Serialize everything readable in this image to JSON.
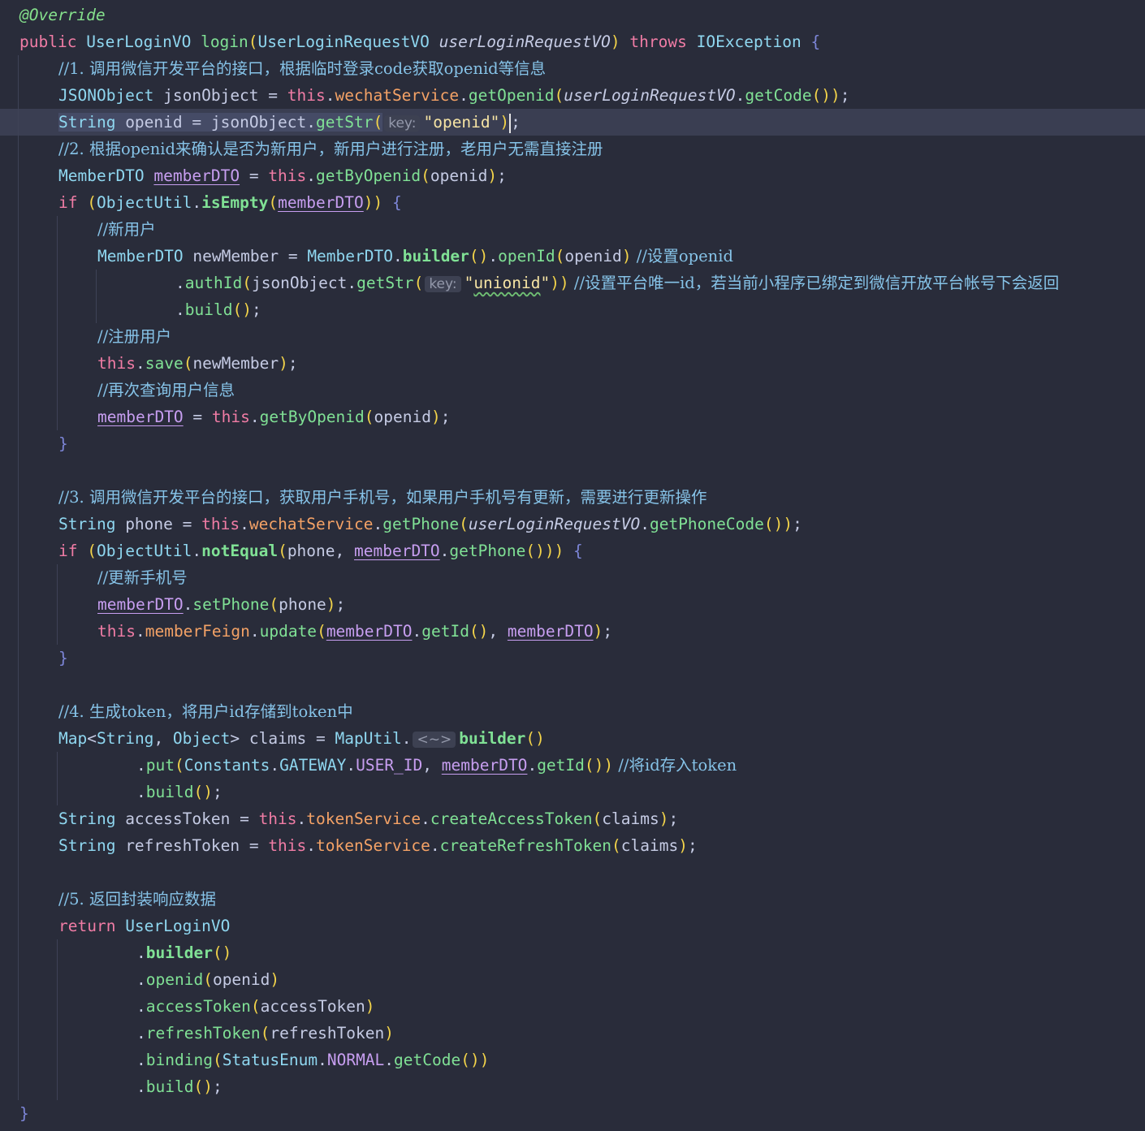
{
  "editor": {
    "language": "Java",
    "colors": {
      "background": "#292c3a",
      "current_line": "#3a3e52",
      "keyword": "#f07ca5",
      "type": "#8fd7f0",
      "method": "#80e195",
      "field": "#f4a266",
      "string": "#f6e4a4",
      "comment": "#86c3e8",
      "reassigned_variable": "#c79ef0"
    },
    "current_line_index": 4,
    "lines": [
      {
        "indent": 0,
        "tokens": [
          [
            "annot",
            "@Override"
          ]
        ]
      },
      {
        "indent": 0,
        "tokens": [
          [
            "kw",
            "public "
          ],
          [
            "cls",
            "UserLoginVO "
          ],
          [
            "fn",
            "login"
          ],
          [
            "paren",
            "("
          ],
          [
            "cls",
            "UserLoginRequestVO "
          ],
          [
            "param",
            "userLoginRequestVO"
          ],
          [
            "paren",
            ")"
          ],
          [
            "kw",
            " throws "
          ],
          [
            "cls",
            "IOException "
          ],
          [
            "brace",
            "{"
          ]
        ]
      },
      {
        "indent": 1,
        "tokens": [
          [
            "cmt",
            "//1. 调用微信开发平台的接口，根据临时登录code获取openid等信息"
          ]
        ]
      },
      {
        "indent": 1,
        "tokens": [
          [
            "cls",
            "JSONObject "
          ],
          [
            "local",
            "jsonObject"
          ],
          [
            "punct",
            " = "
          ],
          [
            "kw",
            "this"
          ],
          [
            "punct",
            "."
          ],
          [
            "field",
            "wechatService"
          ],
          [
            "punct",
            "."
          ],
          [
            "fn",
            "getOpenid"
          ],
          [
            "paren",
            "("
          ],
          [
            "param",
            "userLoginRequestVO"
          ],
          [
            "punct",
            "."
          ],
          [
            "fn",
            "getCode"
          ],
          [
            "paren",
            "())"
          ],
          [
            "punct",
            ";"
          ]
        ]
      },
      {
        "indent": 1,
        "tokens": [
          [
            "cls sel",
            "String"
          ],
          [
            "local sel",
            " openid = "
          ],
          [
            "local sel",
            "jsonObject"
          ],
          [
            "punct sel",
            "."
          ],
          [
            "fn sel",
            "getStr"
          ],
          [
            "paren sel",
            "("
          ],
          [
            "hint",
            "key:"
          ],
          [
            "str",
            "\"openid\""
          ],
          [
            "paren",
            ")"
          ],
          [
            "caret",
            ""
          ],
          [
            "punct",
            ";"
          ]
        ]
      },
      {
        "indent": 1,
        "tokens": [
          [
            "cmt",
            "//2. 根据openid来确认是否为新用户，新用户进行注册，老用户无需直接注册"
          ]
        ]
      },
      {
        "indent": 1,
        "tokens": [
          [
            "cls",
            "MemberDTO "
          ],
          [
            "var",
            "memberDTO"
          ],
          [
            "punct",
            " = "
          ],
          [
            "kw",
            "this"
          ],
          [
            "punct",
            "."
          ],
          [
            "fn",
            "getByOpenid"
          ],
          [
            "paren",
            "("
          ],
          [
            "local",
            "openid"
          ],
          [
            "paren",
            ")"
          ],
          [
            "punct",
            ";"
          ]
        ]
      },
      {
        "indent": 1,
        "tokens": [
          [
            "kw",
            "if "
          ],
          [
            "paren",
            "("
          ],
          [
            "cls",
            "ObjectUtil"
          ],
          [
            "punct",
            "."
          ],
          [
            "fnb",
            "isEmpty"
          ],
          [
            "paren",
            "("
          ],
          [
            "var",
            "memberDTO"
          ],
          [
            "paren",
            "))"
          ],
          [
            "brace",
            " {"
          ]
        ]
      },
      {
        "indent": 2,
        "tokens": [
          [
            "cmt",
            "//新用户"
          ]
        ]
      },
      {
        "indent": 2,
        "tokens": [
          [
            "cls",
            "MemberDTO "
          ],
          [
            "local",
            "newMember"
          ],
          [
            "punct",
            " = "
          ],
          [
            "cls",
            "MemberDTO"
          ],
          [
            "punct",
            "."
          ],
          [
            "fnb",
            "builder"
          ],
          [
            "paren",
            "()"
          ],
          [
            "punct",
            "."
          ],
          [
            "fn",
            "openId"
          ],
          [
            "paren",
            "("
          ],
          [
            "local",
            "openid"
          ],
          [
            "paren",
            ")"
          ],
          [
            "cmt",
            " //设置openid"
          ]
        ]
      },
      {
        "indent": 4,
        "tokens": [
          [
            "punct",
            "."
          ],
          [
            "fn",
            "authId"
          ],
          [
            "paren",
            "("
          ],
          [
            "local",
            "jsonObject"
          ],
          [
            "punct",
            "."
          ],
          [
            "fn",
            "getStr"
          ],
          [
            "paren",
            "("
          ],
          [
            "hint",
            "key:"
          ],
          [
            "str",
            "\""
          ],
          [
            "str typo",
            "unionid"
          ],
          [
            "str",
            "\""
          ],
          [
            "paren",
            "))"
          ],
          [
            "cmt",
            " //设置平台唯一id，若当前小程序已绑定到微信开放平台帐号下会返回"
          ]
        ]
      },
      {
        "indent": 4,
        "tokens": [
          [
            "punct",
            "."
          ],
          [
            "fn",
            "build"
          ],
          [
            "paren",
            "()"
          ],
          [
            "punct",
            ";"
          ]
        ]
      },
      {
        "indent": 2,
        "tokens": [
          [
            "cmt",
            "//注册用户"
          ]
        ]
      },
      {
        "indent": 2,
        "tokens": [
          [
            "kw",
            "this"
          ],
          [
            "punct",
            "."
          ],
          [
            "fn",
            "save"
          ],
          [
            "paren",
            "("
          ],
          [
            "local",
            "newMember"
          ],
          [
            "paren",
            ")"
          ],
          [
            "punct",
            ";"
          ]
        ]
      },
      {
        "indent": 2,
        "tokens": [
          [
            "cmt",
            "//再次查询用户信息"
          ]
        ]
      },
      {
        "indent": 2,
        "tokens": [
          [
            "var",
            "memberDTO"
          ],
          [
            "punct",
            " = "
          ],
          [
            "kw",
            "this"
          ],
          [
            "punct",
            "."
          ],
          [
            "fn",
            "getByOpenid"
          ],
          [
            "paren",
            "("
          ],
          [
            "local",
            "openid"
          ],
          [
            "paren",
            ")"
          ],
          [
            "punct",
            ";"
          ]
        ]
      },
      {
        "indent": 1,
        "tokens": [
          [
            "brace",
            "}"
          ]
        ]
      },
      {
        "indent": 0,
        "tokens": []
      },
      {
        "indent": 1,
        "tokens": [
          [
            "cmt",
            "//3. 调用微信开发平台的接口，获取用户手机号，如果用户手机号有更新，需要进行更新操作"
          ]
        ]
      },
      {
        "indent": 1,
        "tokens": [
          [
            "cls",
            "String "
          ],
          [
            "local",
            "phone"
          ],
          [
            "punct",
            " = "
          ],
          [
            "kw",
            "this"
          ],
          [
            "punct",
            "."
          ],
          [
            "field",
            "wechatService"
          ],
          [
            "punct",
            "."
          ],
          [
            "fn",
            "getPhone"
          ],
          [
            "paren",
            "("
          ],
          [
            "param",
            "userLoginRequestVO"
          ],
          [
            "punct",
            "."
          ],
          [
            "fn",
            "getPhoneCode"
          ],
          [
            "paren",
            "())"
          ],
          [
            "punct",
            ";"
          ]
        ]
      },
      {
        "indent": 1,
        "tokens": [
          [
            "kw",
            "if "
          ],
          [
            "paren",
            "("
          ],
          [
            "cls",
            "ObjectUtil"
          ],
          [
            "punct",
            "."
          ],
          [
            "fnb",
            "notEqual"
          ],
          [
            "paren",
            "("
          ],
          [
            "local",
            "phone"
          ],
          [
            "punct",
            ", "
          ],
          [
            "var",
            "memberDTO"
          ],
          [
            "punct",
            "."
          ],
          [
            "fn",
            "getPhone"
          ],
          [
            "paren",
            "()))"
          ],
          [
            "brace",
            " {"
          ]
        ]
      },
      {
        "indent": 2,
        "tokens": [
          [
            "cmt",
            "//更新手机号"
          ]
        ]
      },
      {
        "indent": 2,
        "tokens": [
          [
            "var",
            "memberDTO"
          ],
          [
            "punct",
            "."
          ],
          [
            "fn",
            "setPhone"
          ],
          [
            "paren",
            "("
          ],
          [
            "local",
            "phone"
          ],
          [
            "paren",
            ")"
          ],
          [
            "punct",
            ";"
          ]
        ]
      },
      {
        "indent": 2,
        "tokens": [
          [
            "kw",
            "this"
          ],
          [
            "punct",
            "."
          ],
          [
            "field",
            "memberFeign"
          ],
          [
            "punct",
            "."
          ],
          [
            "fn",
            "update"
          ],
          [
            "paren",
            "("
          ],
          [
            "var",
            "memberDTO"
          ],
          [
            "punct",
            "."
          ],
          [
            "fn",
            "getId"
          ],
          [
            "paren",
            "()"
          ],
          [
            "punct",
            ", "
          ],
          [
            "var",
            "memberDTO"
          ],
          [
            "paren",
            ")"
          ],
          [
            "punct",
            ";"
          ]
        ]
      },
      {
        "indent": 1,
        "tokens": [
          [
            "brace",
            "}"
          ]
        ]
      },
      {
        "indent": 0,
        "tokens": []
      },
      {
        "indent": 1,
        "tokens": [
          [
            "cmt",
            "//4. 生成token，将用户id存储到token中"
          ]
        ]
      },
      {
        "indent": 1,
        "tokens": [
          [
            "cls",
            "Map"
          ],
          [
            "punct",
            "<"
          ],
          [
            "cls",
            "String"
          ],
          [
            "punct",
            ", "
          ],
          [
            "cls",
            "Object"
          ],
          [
            "punct",
            "> "
          ],
          [
            "local",
            "claims"
          ],
          [
            "punct",
            " = "
          ],
          [
            "cls",
            "MapUtil"
          ],
          [
            "punct",
            "."
          ],
          [
            "hint",
            "<~>"
          ],
          [
            "fnb",
            "builder"
          ],
          [
            "paren",
            "()"
          ]
        ]
      },
      {
        "indent": 3,
        "tokens": [
          [
            "punct",
            "."
          ],
          [
            "fn",
            "put"
          ],
          [
            "paren",
            "("
          ],
          [
            "cls",
            "Constants"
          ],
          [
            "punct",
            "."
          ],
          [
            "cls",
            "GATEWAY"
          ],
          [
            "punct",
            "."
          ],
          [
            "var2",
            "USER_ID"
          ],
          [
            "punct",
            ", "
          ],
          [
            "var",
            "memberDTO"
          ],
          [
            "punct",
            "."
          ],
          [
            "fn",
            "getId"
          ],
          [
            "paren",
            "())"
          ],
          [
            "cmt",
            " //将id存入token"
          ]
        ]
      },
      {
        "indent": 3,
        "tokens": [
          [
            "punct",
            "."
          ],
          [
            "fn",
            "build"
          ],
          [
            "paren",
            "()"
          ],
          [
            "punct",
            ";"
          ]
        ]
      },
      {
        "indent": 1,
        "tokens": [
          [
            "cls",
            "String "
          ],
          [
            "local",
            "accessToken"
          ],
          [
            "punct",
            " = "
          ],
          [
            "kw",
            "this"
          ],
          [
            "punct",
            "."
          ],
          [
            "field",
            "tokenService"
          ],
          [
            "punct",
            "."
          ],
          [
            "fn",
            "createAccessToken"
          ],
          [
            "paren",
            "("
          ],
          [
            "local",
            "claims"
          ],
          [
            "paren",
            ")"
          ],
          [
            "punct",
            ";"
          ]
        ]
      },
      {
        "indent": 1,
        "tokens": [
          [
            "cls",
            "String "
          ],
          [
            "local",
            "refreshToken"
          ],
          [
            "punct",
            " = "
          ],
          [
            "kw",
            "this"
          ],
          [
            "punct",
            "."
          ],
          [
            "field",
            "tokenService"
          ],
          [
            "punct",
            "."
          ],
          [
            "fn",
            "createRefreshToken"
          ],
          [
            "paren",
            "("
          ],
          [
            "local",
            "claims"
          ],
          [
            "paren",
            ")"
          ],
          [
            "punct",
            ";"
          ]
        ]
      },
      {
        "indent": 0,
        "tokens": []
      },
      {
        "indent": 1,
        "tokens": [
          [
            "cmt",
            "//5. 返回封装响应数据"
          ]
        ]
      },
      {
        "indent": 1,
        "tokens": [
          [
            "kw",
            "return "
          ],
          [
            "cls",
            "UserLoginVO"
          ]
        ]
      },
      {
        "indent": 3,
        "tokens": [
          [
            "punct",
            "."
          ],
          [
            "fnb",
            "builder"
          ],
          [
            "paren",
            "()"
          ]
        ]
      },
      {
        "indent": 3,
        "tokens": [
          [
            "punct",
            "."
          ],
          [
            "fn",
            "openid"
          ],
          [
            "paren",
            "("
          ],
          [
            "local",
            "openid"
          ],
          [
            "paren",
            ")"
          ]
        ]
      },
      {
        "indent": 3,
        "tokens": [
          [
            "punct",
            "."
          ],
          [
            "fn",
            "accessToken"
          ],
          [
            "paren",
            "("
          ],
          [
            "local",
            "accessToken"
          ],
          [
            "paren",
            ")"
          ]
        ]
      },
      {
        "indent": 3,
        "tokens": [
          [
            "punct",
            "."
          ],
          [
            "fn",
            "refreshToken"
          ],
          [
            "paren",
            "("
          ],
          [
            "local",
            "refreshToken"
          ],
          [
            "paren",
            ")"
          ]
        ]
      },
      {
        "indent": 3,
        "tokens": [
          [
            "punct",
            "."
          ],
          [
            "fn",
            "binding"
          ],
          [
            "paren",
            "("
          ],
          [
            "cls",
            "StatusEnum"
          ],
          [
            "punct",
            "."
          ],
          [
            "var2",
            "NORMAL"
          ],
          [
            "punct",
            "."
          ],
          [
            "fn",
            "getCode"
          ],
          [
            "paren",
            "())"
          ]
        ]
      },
      {
        "indent": 3,
        "tokens": [
          [
            "punct",
            "."
          ],
          [
            "fn",
            "build"
          ],
          [
            "paren",
            "()"
          ],
          [
            "punct",
            ";"
          ]
        ]
      },
      {
        "indent": 0,
        "tokens": [
          [
            "brace",
            "}"
          ]
        ]
      }
    ]
  }
}
